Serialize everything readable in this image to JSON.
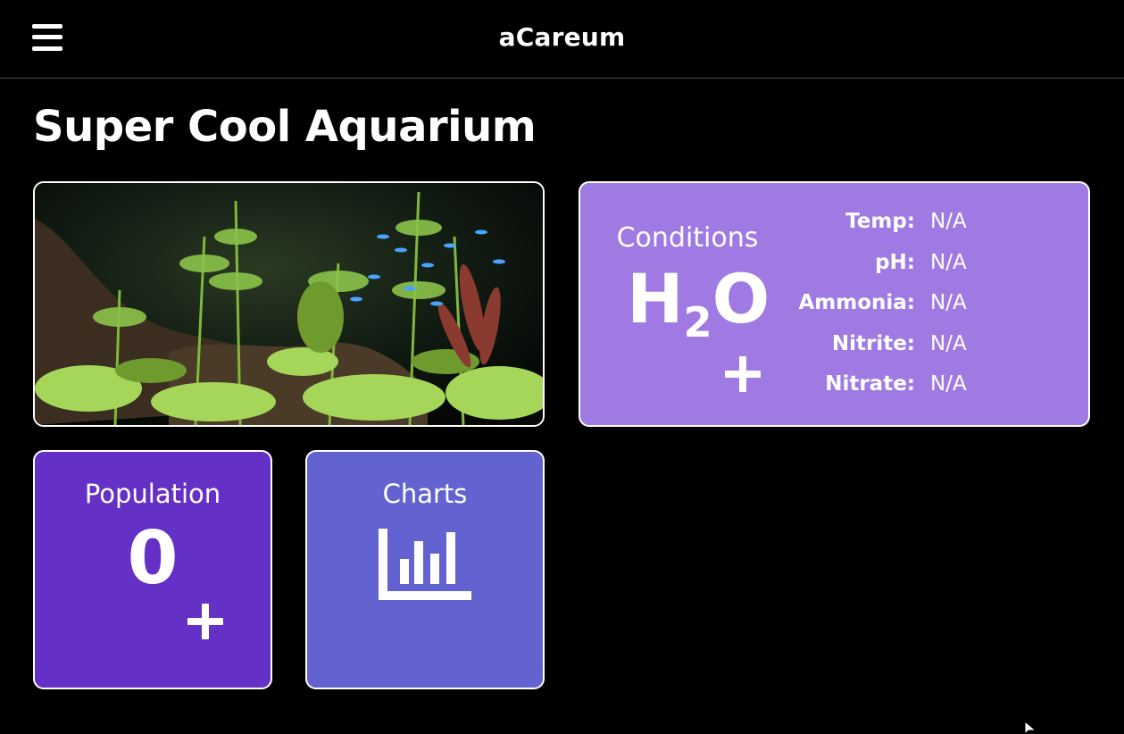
{
  "app": {
    "title": "aCareum"
  },
  "page": {
    "title": "Super Cool Aquarium"
  },
  "conditions": {
    "label": "Conditions",
    "formula_main": "H",
    "formula_sub": "2",
    "formula_end": "O",
    "readings": [
      {
        "label": "Temp:",
        "value": "N/A"
      },
      {
        "label": "pH:",
        "value": "N/A"
      },
      {
        "label": "Ammonia:",
        "value": "N/A"
      },
      {
        "label": "Nitrite:",
        "value": "N/A"
      },
      {
        "label": "Nitrate:",
        "value": "N/A"
      }
    ]
  },
  "population": {
    "label": "Population",
    "count": "0"
  },
  "charts": {
    "label": "Charts"
  },
  "icons": {
    "menu": "hamburger-menu-icon",
    "add": "plus-icon",
    "charts": "bar-chart-icon"
  },
  "colors": {
    "background": "#000000",
    "conditions_card": "#9f7ae3",
    "population_card": "#6530c6",
    "charts_card": "#6262d0"
  }
}
